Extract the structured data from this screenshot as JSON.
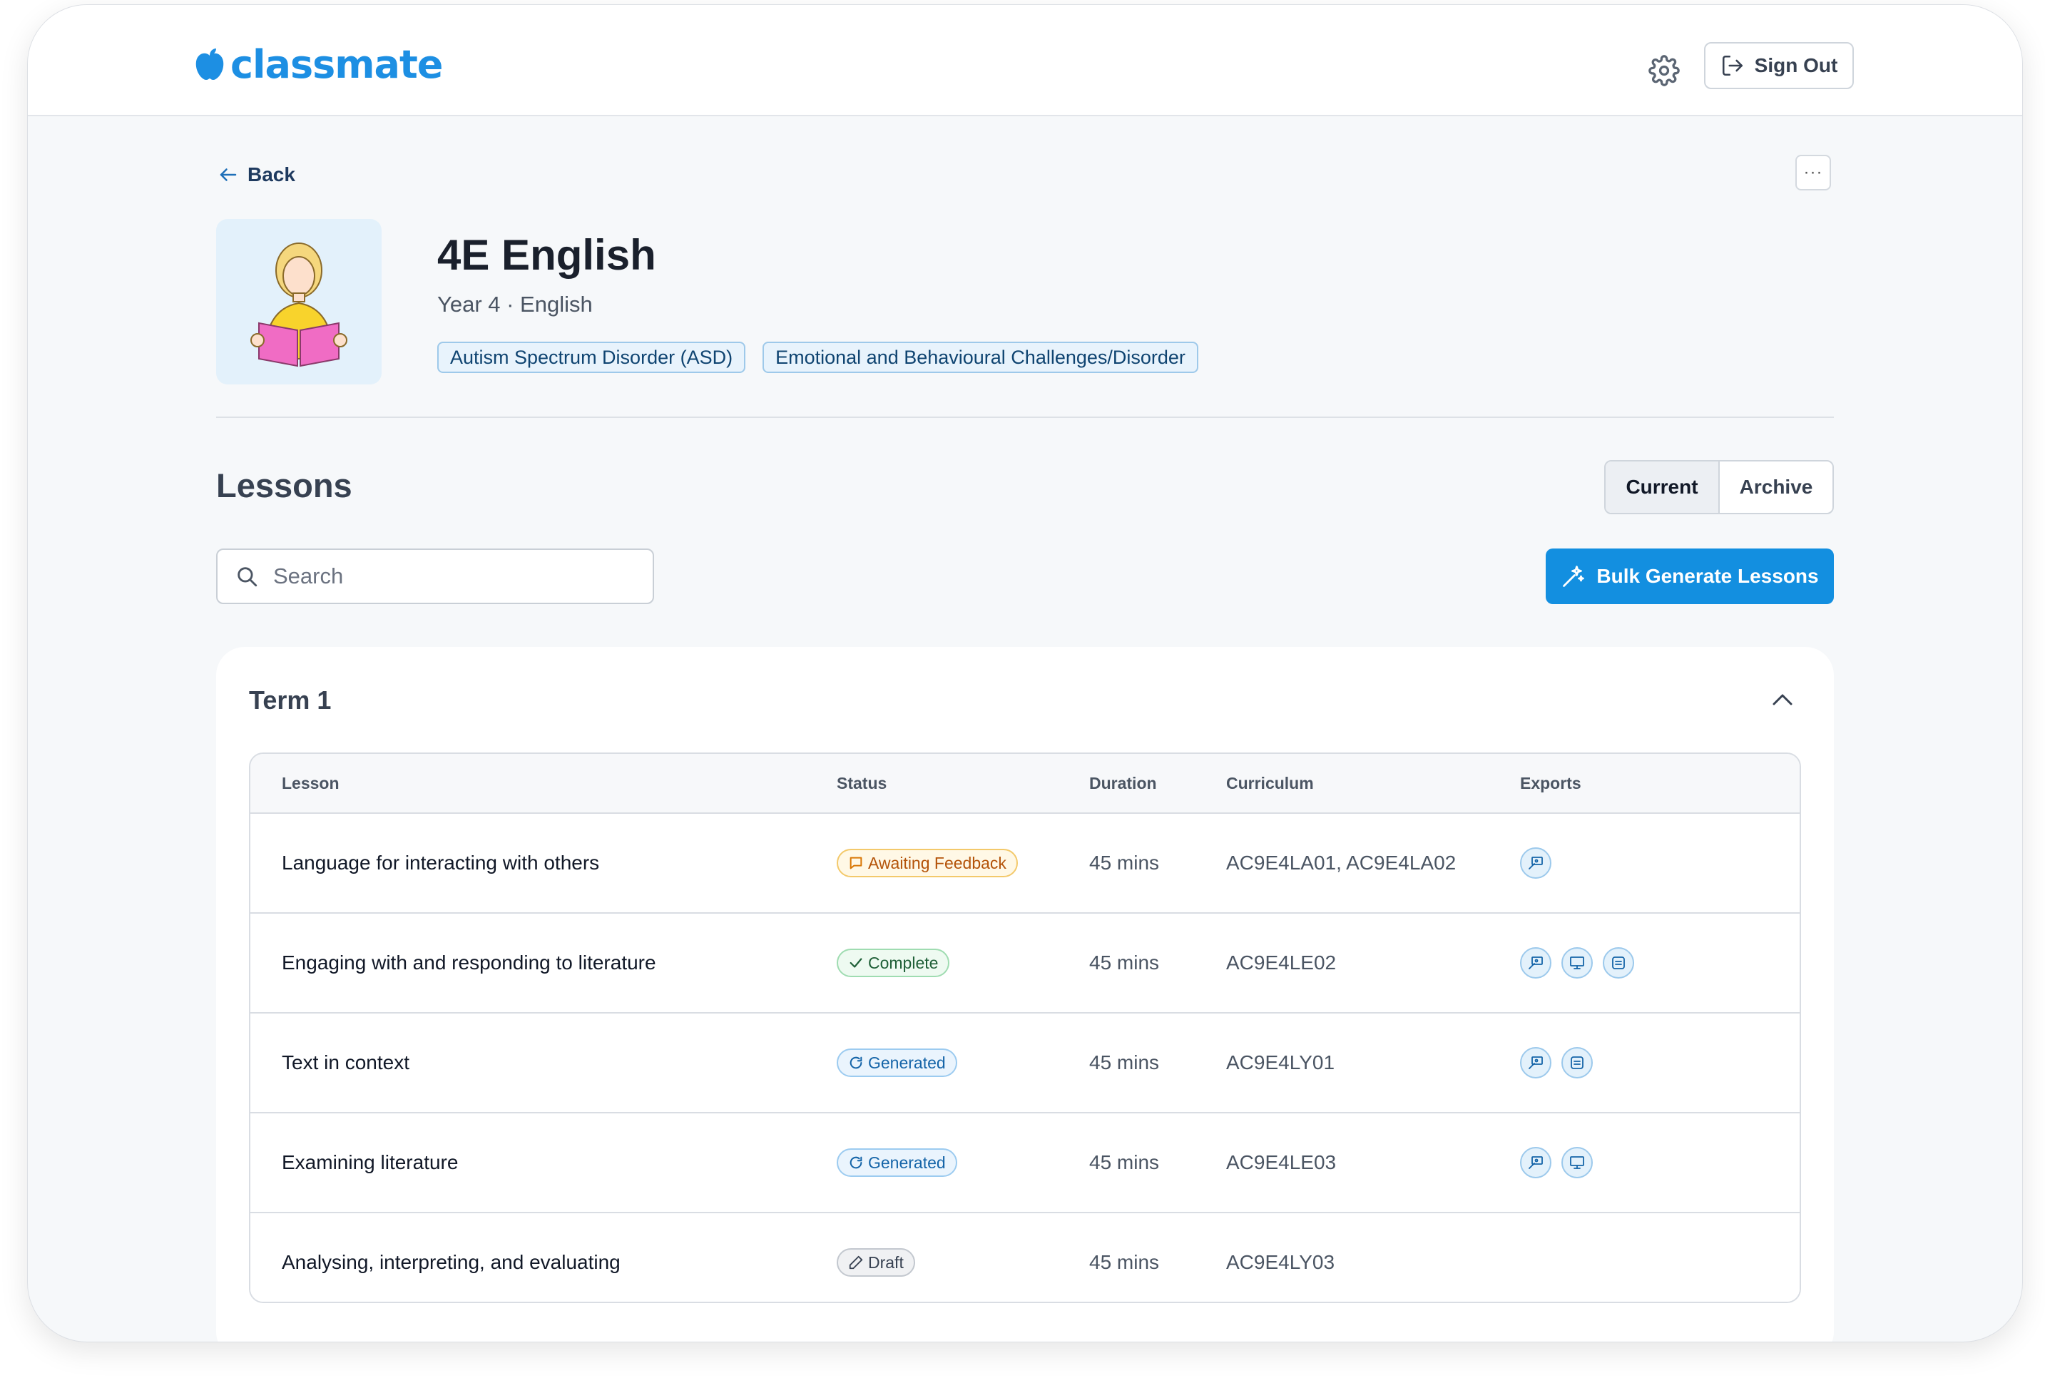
{
  "app": {
    "logo": "classmate"
  },
  "header": {
    "sign_out": "Sign Out"
  },
  "nav": {
    "back": "Back",
    "more": "···"
  },
  "class": {
    "title": "4E English",
    "subtitle": "Year 4 · English",
    "tags": [
      "Autism Spectrum Disorder (ASD)",
      "Emotional and Behavioural Challenges/Disorder"
    ]
  },
  "lessons": {
    "title": "Lessons",
    "toggle": [
      "Current",
      "Archive"
    ],
    "search_placeholder": "Search",
    "bulk_button": "Bulk Generate Lessons"
  },
  "term": {
    "title": "Term 1",
    "columns": [
      "Lesson",
      "Status",
      "Duration",
      "Curriculum",
      "Exports"
    ],
    "rows": [
      {
        "lesson": "Language for interacting with others",
        "status": "Awaiting Feedback",
        "duration": "45 mins",
        "curriculum": "AC9E4LA01, AC9E4LA02"
      },
      {
        "lesson": "Engaging with and responding to literature",
        "status": "Complete",
        "duration": "45 mins",
        "curriculum": "AC9E4LE02"
      },
      {
        "lesson": "Text in context",
        "status": "Generated",
        "duration": "45 mins",
        "curriculum": "AC9E4LY01"
      },
      {
        "lesson": "Examining literature",
        "status": "Generated",
        "duration": "45 mins",
        "curriculum": "AC9E4LE03"
      },
      {
        "lesson": "Analysing, interpreting, and evaluating",
        "status": "Draft",
        "duration": "45 mins",
        "curriculum": "AC9E4LY03"
      }
    ]
  },
  "colors": {
    "primary": "#138fe0",
    "logo": "#1d8fe3"
  }
}
